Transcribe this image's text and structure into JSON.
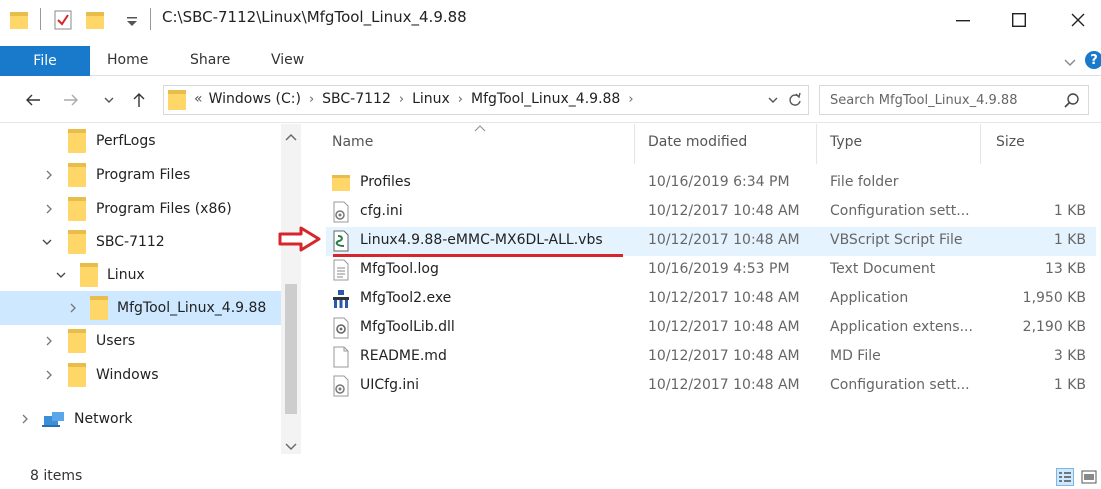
{
  "window": {
    "title": "C:\\SBC-7112\\Linux\\MfgTool_Linux_4.9.88"
  },
  "ribbon": {
    "tabs": [
      "File",
      "Home",
      "Share",
      "View"
    ]
  },
  "address": {
    "prefix": "«",
    "crumbs": [
      "Windows (C:)",
      "SBC-7112",
      "Linux",
      "MfgTool_Linux_4.9.88"
    ]
  },
  "search": {
    "placeholder": "Search MfgTool_Linux_4.9.88"
  },
  "nav": {
    "items": [
      {
        "label": "PerfLogs"
      },
      {
        "label": "Program Files"
      },
      {
        "label": "Program Files (x86)"
      },
      {
        "label": "SBC-7112"
      },
      {
        "label": "Linux"
      },
      {
        "label": "MfgTool_Linux_4.9.88"
      },
      {
        "label": "Users"
      },
      {
        "label": "Windows"
      },
      {
        "label": "Network"
      }
    ]
  },
  "columns": {
    "name": "Name",
    "date": "Date modified",
    "type": "Type",
    "size": "Size"
  },
  "files": [
    {
      "name": "Profiles",
      "date": "10/16/2019 6:34 PM",
      "type": "File folder",
      "size": "",
      "icon": "folder-icon"
    },
    {
      "name": "cfg.ini",
      "date": "10/12/2017 10:48 AM",
      "type": "Configuration sett...",
      "size": "1 KB",
      "icon": "ini-file-icon"
    },
    {
      "name": "Linux4.9.88-eMMC-MX6DL-ALL.vbs",
      "date": "10/12/2017 10:48 AM",
      "type": "VBScript Script File",
      "size": "1 KB",
      "icon": "vbs-script-icon"
    },
    {
      "name": "MfgTool.log",
      "date": "10/16/2019 4:53 PM",
      "type": "Text Document",
      "size": "13 KB",
      "icon": "text-file-icon"
    },
    {
      "name": "MfgTool2.exe",
      "date": "10/12/2017 10:48 AM",
      "type": "Application",
      "size": "1,950 KB",
      "icon": "exe-app-icon"
    },
    {
      "name": "MfgToolLib.dll",
      "date": "10/12/2017 10:48 AM",
      "type": "Application extens...",
      "size": "2,190 KB",
      "icon": "dll-file-icon"
    },
    {
      "name": "README.md",
      "date": "10/12/2017 10:48 AM",
      "type": "MD File",
      "size": "3 KB",
      "icon": "blank-file-icon"
    },
    {
      "name": "UICfg.ini",
      "date": "10/12/2017 10:48 AM",
      "type": "Configuration sett...",
      "size": "1 KB",
      "icon": "ini-file-icon"
    }
  ],
  "status": {
    "count": "8 items"
  },
  "colors": {
    "accent": "#1979ca",
    "selection": "#cde8ff",
    "highlight_row": "#e5f3ff",
    "annotation": "#d6262c"
  }
}
